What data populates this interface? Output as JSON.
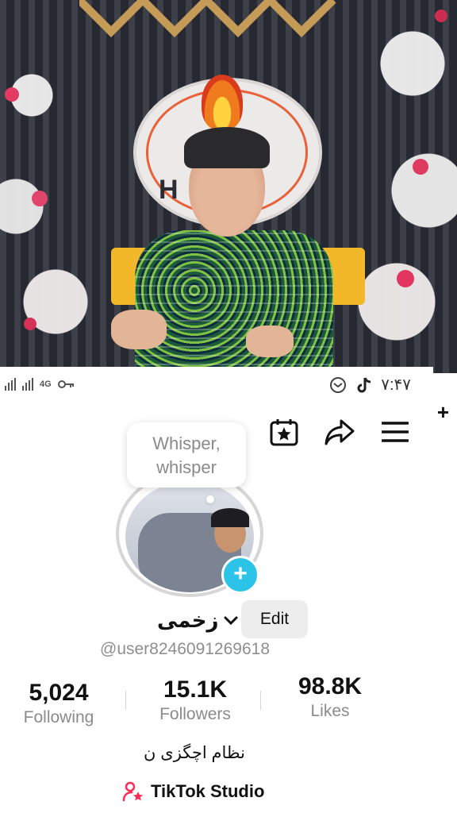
{
  "status_bar": {
    "network": "4G",
    "time": "۷:۴۷"
  },
  "note": {
    "text_line1": "Whisper,",
    "text_line2": "whisper"
  },
  "profile": {
    "name": "زخمی",
    "edit_label": "Edit",
    "handle": "@user8246091269618",
    "bio": "نظام اچگزی ن",
    "studio_label": "TikTok Studio"
  },
  "stats": [
    {
      "value": "5,024",
      "label": "Following"
    },
    {
      "value": "15.1K",
      "label": "Followers"
    },
    {
      "value": "98.8K",
      "label": "Likes"
    }
  ],
  "icons": {
    "calendar": "calendar-star-icon",
    "share": "share-icon",
    "menu": "menu-icon"
  },
  "colors": {
    "accent": "#2cc3e8",
    "studio_icon": "#fe2c55"
  }
}
